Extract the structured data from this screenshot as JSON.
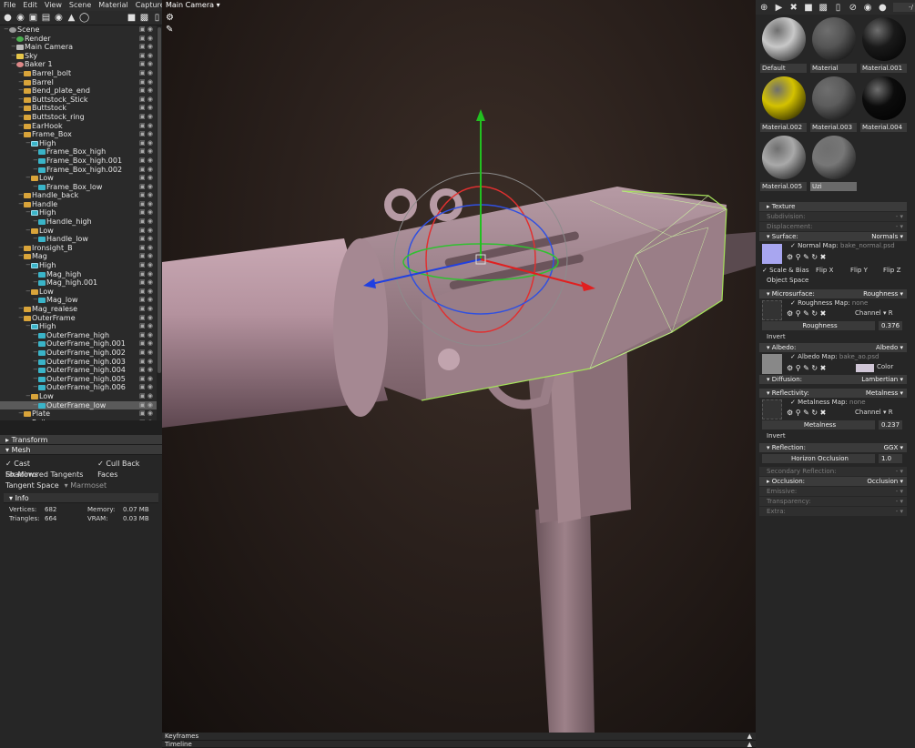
{
  "menu": [
    "File",
    "Edit",
    "View",
    "Scene",
    "Material",
    "Capture",
    "Help"
  ],
  "viewport": {
    "camera_label": "Main Camera ▾"
  },
  "outliner": [
    {
      "label": "Scene",
      "indent": 0,
      "icon": "scene"
    },
    {
      "label": "Render",
      "indent": 1,
      "icon": "render"
    },
    {
      "label": "Main Camera",
      "indent": 1,
      "icon": "cam"
    },
    {
      "label": "Sky",
      "indent": 1,
      "icon": "sky"
    },
    {
      "label": "Baker 1",
      "indent": 1,
      "icon": "baker"
    },
    {
      "label": "Barrel_bolt",
      "indent": 2,
      "icon": "folder"
    },
    {
      "label": "Barrel",
      "indent": 2,
      "icon": "folder"
    },
    {
      "label": "Bend_plate_end",
      "indent": 2,
      "icon": "folder"
    },
    {
      "label": "Buttstock_Stick",
      "indent": 2,
      "icon": "folder"
    },
    {
      "label": "Buttstock",
      "indent": 2,
      "icon": "folder"
    },
    {
      "label": "Buttstock_ring",
      "indent": 2,
      "icon": "folder"
    },
    {
      "label": "EarHook",
      "indent": 2,
      "icon": "folder"
    },
    {
      "label": "Frame_Box",
      "indent": 2,
      "icon": "folder"
    },
    {
      "label": "High",
      "indent": 3,
      "icon": "grp"
    },
    {
      "label": "Frame_Box_high",
      "indent": 4,
      "icon": "mesh"
    },
    {
      "label": "Frame_Box_high.001",
      "indent": 4,
      "icon": "mesh"
    },
    {
      "label": "Frame_Box_high.002",
      "indent": 4,
      "icon": "mesh"
    },
    {
      "label": "Low",
      "indent": 3,
      "icon": "folder"
    },
    {
      "label": "Frame_Box_low",
      "indent": 4,
      "icon": "mesh"
    },
    {
      "label": "Handle_back",
      "indent": 2,
      "icon": "folder"
    },
    {
      "label": "Handle",
      "indent": 2,
      "icon": "folder"
    },
    {
      "label": "High",
      "indent": 3,
      "icon": "grp"
    },
    {
      "label": "Handle_high",
      "indent": 4,
      "icon": "mesh"
    },
    {
      "label": "Low",
      "indent": 3,
      "icon": "folder"
    },
    {
      "label": "Handle_low",
      "indent": 4,
      "icon": "mesh"
    },
    {
      "label": "Ironsight_B",
      "indent": 2,
      "icon": "folder"
    },
    {
      "label": "Mag",
      "indent": 2,
      "icon": "folder"
    },
    {
      "label": "High",
      "indent": 3,
      "icon": "grp"
    },
    {
      "label": "Mag_high",
      "indent": 4,
      "icon": "mesh"
    },
    {
      "label": "Mag_high.001",
      "indent": 4,
      "icon": "mesh"
    },
    {
      "label": "Low",
      "indent": 3,
      "icon": "folder"
    },
    {
      "label": "Mag_low",
      "indent": 4,
      "icon": "mesh"
    },
    {
      "label": "Mag_realese",
      "indent": 2,
      "icon": "folder"
    },
    {
      "label": "OuterFrame",
      "indent": 2,
      "icon": "folder"
    },
    {
      "label": "High",
      "indent": 3,
      "icon": "grp"
    },
    {
      "label": "OuterFrame_high",
      "indent": 4,
      "icon": "mesh"
    },
    {
      "label": "OuterFrame_high.001",
      "indent": 4,
      "icon": "mesh"
    },
    {
      "label": "OuterFrame_high.002",
      "indent": 4,
      "icon": "mesh"
    },
    {
      "label": "OuterFrame_high.003",
      "indent": 4,
      "icon": "mesh"
    },
    {
      "label": "OuterFrame_high.004",
      "indent": 4,
      "icon": "mesh"
    },
    {
      "label": "OuterFrame_high.005",
      "indent": 4,
      "icon": "mesh"
    },
    {
      "label": "OuterFrame_high.006",
      "indent": 4,
      "icon": "mesh"
    },
    {
      "label": "Low",
      "indent": 3,
      "icon": "folder"
    },
    {
      "label": "OuterFrame_low",
      "indent": 4,
      "icon": "mesh",
      "selected": true
    },
    {
      "label": "Plate",
      "indent": 2,
      "icon": "folder"
    },
    {
      "label": "Rail",
      "indent": 2,
      "icon": "folder"
    }
  ],
  "properties": {
    "transform": "Transform",
    "mesh": "Mesh",
    "cast_shadows": "Cast Shadows",
    "cull_back_faces": "Cull Back Faces",
    "fix_mirrored": "Fix Mirrored Tangents",
    "tangent_space": "Tangent Space",
    "tangent_value": "Marmoset",
    "info": "Info",
    "vertices_label": "Vertices:",
    "vertices": "682",
    "triangles_label": "Triangles:",
    "triangles": "664",
    "memory_label": "Memory:",
    "memory": "0.07 MB",
    "vram_label": "VRAM:",
    "vram": "0.03 MB"
  },
  "timeline": {
    "keyframes": "Keyframes",
    "timeline": "Timeline"
  },
  "materials": [
    {
      "name": "Default",
      "color": "#c8c8c8"
    },
    {
      "name": "Material",
      "color": "#555555"
    },
    {
      "name": "Material.001",
      "color": "#1a1a1a"
    },
    {
      "name": "Material.002",
      "color": "#d4c200"
    },
    {
      "name": "Material.003",
      "color": "#5c5c5c"
    },
    {
      "name": "Material.004",
      "color": "#0c0c0c"
    },
    {
      "name": "Material.005",
      "color": "#a9a9a9"
    },
    {
      "name": "Uzi",
      "color": "#777777",
      "selected": true
    }
  ],
  "right_top_value": "-/",
  "material": {
    "texture": "Texture",
    "subdivision": "Subdivision:",
    "displacement": "Displacement:",
    "surface": "Surface:",
    "surface_val": "Normals",
    "normal_map_label": "Normal Map:",
    "normal_map_file": "bake_normal.psd",
    "scale_bias": "Scale & Bias",
    "flip_x": "Flip X",
    "flip_y": "Flip Y",
    "flip_z": "Flip Z",
    "object_space": "Object Space",
    "microsurface": "Microsurface:",
    "microsurface_val": "Roughness",
    "roughness_map_label": "Roughness Map:",
    "roughness_map_file": "none",
    "channel": "Channel",
    "channel_val": "R",
    "roughness": "Roughness",
    "roughness_val": "0.376",
    "invert": "Invert",
    "albedo": "Albedo:",
    "albedo_val": "Albedo",
    "albedo_map_label": "Albedo Map:",
    "albedo_map_file": "bake_ao.psd",
    "color": "Color",
    "diffusion": "Diffusion:",
    "diffusion_val": "Lambertian",
    "reflectivity": "Reflectivity:",
    "reflectivity_val": "Metalness",
    "metalness_map_label": "Metalness Map:",
    "metalness_map_file": "none",
    "metalness": "Metalness",
    "metalness_val": "0.237",
    "reflection": "Reflection:",
    "reflection_val": "GGX",
    "horizon": "Horizon Occlusion",
    "horizon_val": "1.0",
    "secondary": "Secondary Reflection:",
    "occlusion": "Occlusion:",
    "occlusion_val": "Occlusion",
    "emissive": "Emissive:",
    "transparency": "Transparency:",
    "extra": "Extra:"
  }
}
